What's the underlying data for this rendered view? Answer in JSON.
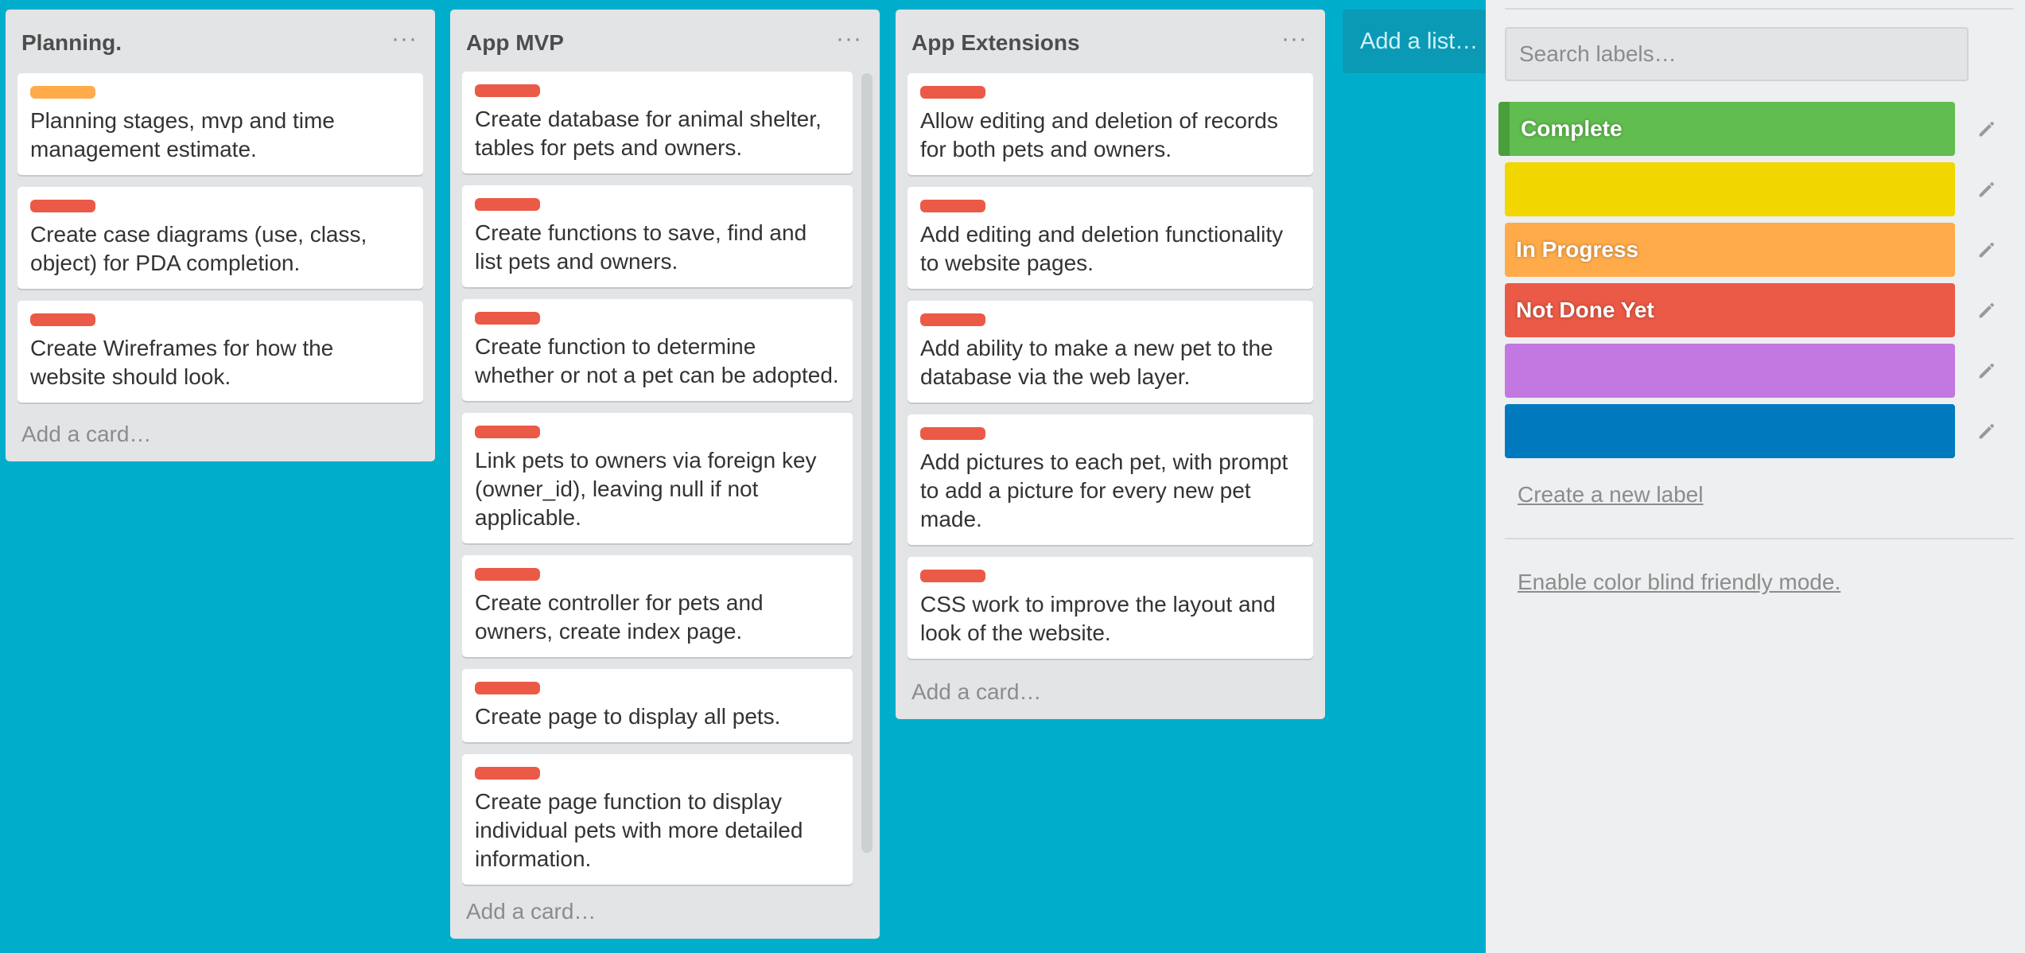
{
  "colors": {
    "board_bg": "#00aecc",
    "label_green": "#61bd4f",
    "label_yellow": "#f2d600",
    "label_orange": "#ffab4a",
    "label_red": "#eb5a46",
    "label_purple": "#c377e0",
    "label_blue": "#0079bf"
  },
  "lists": [
    {
      "title": "Planning.",
      "menu_icon": "ellipsis-icon",
      "add_card": "Add a card…",
      "cards": [
        {
          "label_color": "#ffab4a",
          "text": "Planning stages, mvp and time management estimate."
        },
        {
          "label_color": "#eb5a46",
          "text": "Create case diagrams (use, class, object) for PDA completion."
        },
        {
          "label_color": "#eb5a46",
          "text": "Create Wireframes for how the website should look."
        }
      ]
    },
    {
      "title": "App MVP",
      "menu_icon": "ellipsis-icon",
      "add_card": "Add a card…",
      "cards": [
        {
          "label_color": "#eb5a46",
          "text": "Create database for animal shelter, tables for pets and owners."
        },
        {
          "label_color": "#eb5a46",
          "text": "Create functions to save, find and list pets and owners."
        },
        {
          "label_color": "#eb5a46",
          "text": "Create function to determine whether or not a pet can be adopted."
        },
        {
          "label_color": "#eb5a46",
          "text": "Link pets to owners via foreign key (owner_id), leaving null if not applicable."
        },
        {
          "label_color": "#eb5a46",
          "text": "Create controller for pets and owners, create index page."
        },
        {
          "label_color": "#eb5a46",
          "text": "Create page to display all pets."
        },
        {
          "label_color": "#eb5a46",
          "text": "Create page function to display individual pets with more detailed information."
        }
      ]
    },
    {
      "title": "App Extensions",
      "menu_icon": "ellipsis-icon",
      "add_card": "Add a card…",
      "cards": [
        {
          "label_color": "#eb5a46",
          "text": "Allow editing and deletion of records for both pets and owners."
        },
        {
          "label_color": "#eb5a46",
          "text": "Add editing and deletion functionality to website pages."
        },
        {
          "label_color": "#eb5a46",
          "text": "Add ability to make a new pet to the database via the web layer."
        },
        {
          "label_color": "#eb5a46",
          "text": "Add pictures to each pet, with prompt to add a picture for every new pet made."
        },
        {
          "label_color": "#eb5a46",
          "text": "CSS work to improve the layout and look of the website."
        }
      ]
    }
  ],
  "add_list": "Add a list…",
  "sidebar": {
    "search_placeholder": "Search labels…",
    "labels": [
      {
        "name": "Complete",
        "color": "#61bd4f",
        "selected": true
      },
      {
        "name": "",
        "color": "#f2d600"
      },
      {
        "name": "In Progress",
        "color": "#ffab4a"
      },
      {
        "name": "Not Done Yet",
        "color": "#eb5a46"
      },
      {
        "name": "",
        "color": "#c377e0"
      },
      {
        "name": "",
        "color": "#0079bf"
      }
    ],
    "edit_icon": "pencil-icon",
    "create_label": "Create a new label",
    "color_blind": "Enable color blind friendly mode."
  }
}
